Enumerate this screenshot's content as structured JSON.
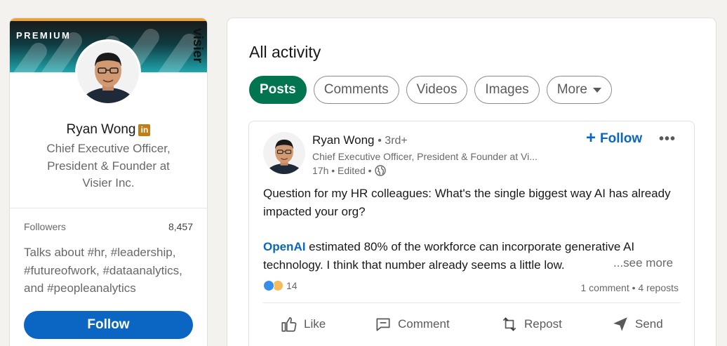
{
  "profile": {
    "premium_label": "PREMIUM",
    "banner_logo": "visier",
    "name": "Ryan Wong",
    "badge": "in",
    "headline": "Chief Executive Officer, President & Founder at Visier Inc.",
    "followers_label": "Followers",
    "followers_count": "8,457",
    "talks_about": "Talks about #hr, #leadership, #futureofwork, #dataanalytics, and #peopleanalytics",
    "follow_label": "Follow"
  },
  "activity": {
    "title": "All activity",
    "filters": [
      {
        "label": "Posts",
        "active": true
      },
      {
        "label": "Comments",
        "active": false
      },
      {
        "label": "Videos",
        "active": false
      },
      {
        "label": "Images",
        "active": false
      },
      {
        "label": "More",
        "active": false
      }
    ]
  },
  "post": {
    "author": "Ryan Wong",
    "degree": "• 3rd+",
    "headline": "Chief Executive Officer, President & Founder at Vi...",
    "meta": "17h • Edited •",
    "follow_label": "Follow",
    "more_label": "•••",
    "body_line1": "Question for my HR colleagues: What's the single biggest way AI has already impacted your org?",
    "body_link": "OpenAI",
    "body_line2": " estimated 80% of the workforce can incorporate generative AI technology. I think that number already seems a little low.",
    "see_more": "...see more",
    "reaction_count": "14",
    "stats": "1 comment • 4 reposts",
    "actions": {
      "like": "Like",
      "comment": "Comment",
      "repost": "Repost",
      "send": "Send"
    }
  },
  "colors": {
    "brand_blue": "#0a66c2",
    "active_pill": "#01754f",
    "premium_gold": "#e7a33e"
  }
}
